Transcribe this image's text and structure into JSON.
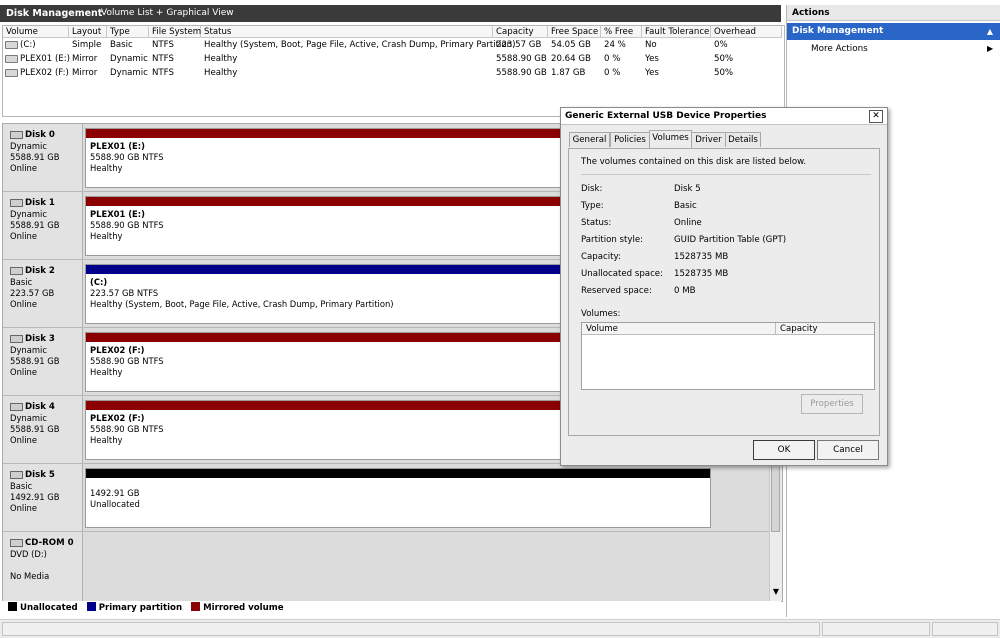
{
  "header": {
    "title": "Disk Management",
    "view": "Volume List + Graphical View"
  },
  "volume_list": {
    "columns": [
      "Volume",
      "Layout",
      "Type",
      "File System",
      "Status",
      "Capacity",
      "Free Space",
      "% Free",
      "Fault Tolerance",
      "Overhead"
    ],
    "rows": [
      [
        "(C:)",
        "Simple",
        "Basic",
        "NTFS",
        "Healthy (System, Boot, Page File, Active, Crash Dump, Primary Partition)",
        "223.57 GB",
        "54.05 GB",
        "24 %",
        "No",
        "0%"
      ],
      [
        "PLEX01 (E:)",
        "Mirror",
        "Dynamic",
        "NTFS",
        "Healthy",
        "5588.90 GB",
        "20.64 GB",
        "0 %",
        "Yes",
        "50%"
      ],
      [
        "PLEX02 (F:)",
        "Mirror",
        "Dynamic",
        "NTFS",
        "Healthy",
        "5588.90 GB",
        "1.87 GB",
        "0 %",
        "Yes",
        "50%"
      ]
    ]
  },
  "disks": [
    {
      "name": "Disk 0",
      "type": "Dynamic",
      "size": "5588.91 GB",
      "state": "Online",
      "bar_color": "#8b0000",
      "part_name": "PLEX01  (E:)",
      "part_size": "5588.90 GB NTFS",
      "part_status": "Healthy"
    },
    {
      "name": "Disk 1",
      "type": "Dynamic",
      "size": "5588.91 GB",
      "state": "Online",
      "bar_color": "#8b0000",
      "part_name": "PLEX01  (E:)",
      "part_size": "5588.90 GB NTFS",
      "part_status": "Healthy"
    },
    {
      "name": "Disk 2",
      "type": "Basic",
      "size": "223.57 GB",
      "state": "Online",
      "bar_color": "#00008b",
      "part_name": "(C:)",
      "part_size": "223.57 GB NTFS",
      "part_status": "Healthy (System, Boot, Page File, Active, Crash Dump, Primary Partition)"
    },
    {
      "name": "Disk 3",
      "type": "Dynamic",
      "size": "5588.91 GB",
      "state": "Online",
      "bar_color": "#8b0000",
      "part_name": "PLEX02  (F:)",
      "part_size": "5588.90 GB NTFS",
      "part_status": "Healthy"
    },
    {
      "name": "Disk 4",
      "type": "Dynamic",
      "size": "5588.91 GB",
      "state": "Online",
      "bar_color": "#8b0000",
      "part_name": "PLEX02  (F:)",
      "part_size": "5588.90 GB NTFS",
      "part_status": "Healthy"
    },
    {
      "name": "Disk 5",
      "type": "Basic",
      "size": "1492.91 GB",
      "state": "Online",
      "bar_color": "#000000",
      "part_name": "",
      "part_size": "1492.91 GB",
      "part_status": "Unallocated"
    }
  ],
  "cdrom": {
    "name": "CD-ROM 0",
    "drive": "DVD (D:)",
    "media": "No Media"
  },
  "legend": [
    {
      "label": "Unallocated",
      "color": "#000000"
    },
    {
      "label": "Primary partition",
      "color": "#00008b"
    },
    {
      "label": "Mirrored volume",
      "color": "#8b0000"
    }
  ],
  "actions": {
    "title": "Actions",
    "section": "Disk Management",
    "more": "More Actions"
  },
  "dialog": {
    "title": "Generic External USB Device Properties",
    "close": "✕",
    "tabs": [
      "General",
      "Policies",
      "Volumes",
      "Driver",
      "Details"
    ],
    "active_tab": "Volumes",
    "description": "The volumes contained on this disk are listed below.",
    "properties": [
      {
        "label": "Disk:",
        "value": "Disk 5"
      },
      {
        "label": "Type:",
        "value": "Basic"
      },
      {
        "label": "Status:",
        "value": "Online"
      },
      {
        "label": "Partition style:",
        "value": "GUID Partition Table (GPT)"
      },
      {
        "label": "Capacity:",
        "value": "1528735 MB"
      },
      {
        "label": "Unallocated space:",
        "value": "1528735 MB"
      },
      {
        "label": "Reserved space:",
        "value": "0 MB"
      }
    ],
    "volumes_label": "Volumes:",
    "volume_columns": [
      "Volume",
      "Capacity"
    ],
    "properties_button": "Properties",
    "ok": "OK",
    "cancel": "Cancel"
  }
}
